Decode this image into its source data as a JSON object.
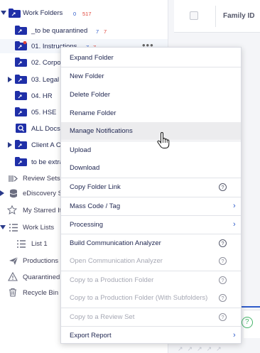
{
  "tree": {
    "root": {
      "label": "Work Folders",
      "count_blue": "0",
      "count_red": "517"
    },
    "folders": [
      {
        "label": "_to be quarantined",
        "count_blue": "7",
        "count_red": "7"
      },
      {
        "label": "01. Instructions",
        "count_blue": "7",
        "count_red": "7"
      },
      {
        "label": "02. Corpo"
      },
      {
        "label": "03. Legal"
      },
      {
        "label": "04. HR"
      },
      {
        "label": "05. HSE"
      },
      {
        "label": "ALL Docs"
      },
      {
        "label": "Client A C"
      },
      {
        "label": "to be extra"
      }
    ],
    "more_glyph": "•••"
  },
  "nav": {
    "review_sets": "Review Sets",
    "ediscovery": "eDiscovery S",
    "starred": "My Starred It",
    "work_lists": "Work Lists",
    "list1": "List 1",
    "productions": "Productions",
    "quarantined": "Quarantined",
    "recycle_bin": "Recycle Bin"
  },
  "grid": {
    "column_header": "Family ID",
    "status_glyph": "?"
  },
  "menu": {
    "expand_folder": "Expand Folder",
    "new_folder": "New Folder",
    "delete_folder": "Delete Folder",
    "rename_folder": "Rename Folder",
    "manage_notifications": "Manage Notifications",
    "upload": "Upload",
    "download": "Download",
    "copy_folder_link": "Copy Folder Link",
    "mass_code_tag": "Mass Code / Tag",
    "processing": "Processing",
    "build_comm_analyzer": "Build Communication Analyzer",
    "open_comm_analyzer": "Open Communication Analyzer",
    "copy_to_production": "Copy to a Production Folder",
    "copy_to_production_sub": "Copy to a Production Folder (With Subfolders)",
    "copy_to_review_set": "Copy to a Review Set",
    "export_report": "Export Report",
    "help_glyph": "?",
    "submenu_glyph": "›"
  },
  "colors": {
    "folder_blue": "#1f2fa8",
    "accent_blue": "#2d5ac9",
    "count_red": "#e0453a",
    "disabled_text": "#a6a8b4"
  }
}
